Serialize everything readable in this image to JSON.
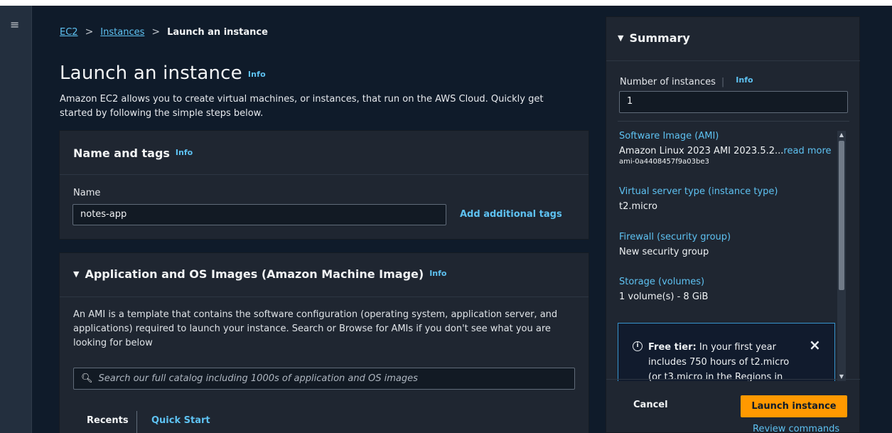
{
  "breadcrumb": {
    "items": [
      {
        "label": "EC2"
      },
      {
        "label": "Instances"
      },
      {
        "label": "Launch an instance"
      }
    ],
    "separators": [
      ">",
      ">"
    ]
  },
  "page": {
    "title": "Launch an instance",
    "info": "Info",
    "description": "Amazon EC2 allows you to create virtual machines, or instances, that run on the AWS Cloud. Quickly get started by following the simple steps below."
  },
  "name_tags": {
    "title": "Name and tags",
    "info": "Info",
    "name_label": "Name",
    "name_value": "notes-app",
    "add_tags": "Add additional tags"
  },
  "ami": {
    "title": "Application and OS Images (Amazon Machine Image)",
    "info": "Info",
    "description": "An AMI is a template that contains the software configuration (operating system, application server, and applications) required to launch your instance. Search or Browse for AMIs if you don't see what you are looking for below",
    "search_placeholder": "Search our full catalog including 1000s of application and OS images",
    "tabs": [
      {
        "label": "Recents",
        "active": true
      },
      {
        "label": "Quick Start",
        "active": false
      }
    ]
  },
  "summary": {
    "title": "Summary",
    "instances_label": "Number of instances",
    "info": "Info",
    "instances_value": "1",
    "items": [
      {
        "title": "Software Image (AMI)",
        "value": "Amazon Linux 2023 AMI 2023.5.2...",
        "value_link": "read more",
        "sub": "ami-0a4408457f9a03be3"
      },
      {
        "title": "Virtual server type (instance type)",
        "value": "t2.micro"
      },
      {
        "title": "Firewall (security group)",
        "value": "New security group"
      },
      {
        "title": "Storage (volumes)",
        "value": "1 volume(s) - 8 GiB"
      }
    ],
    "free_tier": {
      "label": "Free tier:",
      "text": "In your first year includes 750 hours of t2.micro (or t3.micro in the Regions in"
    },
    "cancel": "Cancel",
    "launch": "Launch instance",
    "review": "Review commands"
  },
  "icons": {
    "menu": "menu-icon",
    "triangle": "caret-down-icon",
    "search": "search-icon",
    "info_circle": "info-circle-icon",
    "close": "close-icon"
  },
  "colors": {
    "accent_link": "#5ec2f2",
    "launch_button": "#ff9900",
    "background": "#0f1b2a",
    "panel": "#1f2631"
  }
}
